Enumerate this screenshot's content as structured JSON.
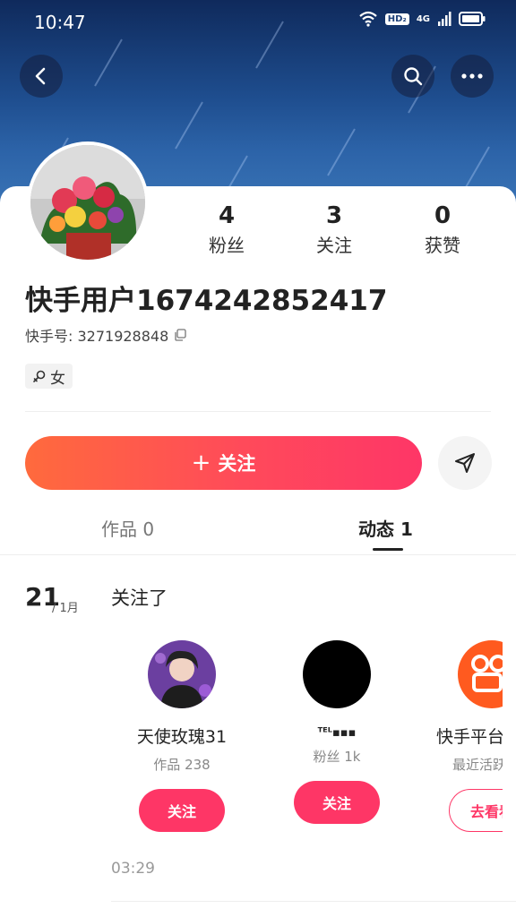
{
  "status_bar": {
    "time": "10:47",
    "hd_badge": "HD₂",
    "network": "4G"
  },
  "header": {
    "icons": [
      "back-icon",
      "search-icon",
      "more-icon"
    ]
  },
  "profile": {
    "name": "快手用户1674242852417",
    "id_label": "快手号: 3271928848",
    "gender": "女",
    "stats": [
      {
        "value": "4",
        "label": "粉丝"
      },
      {
        "value": "3",
        "label": "关注"
      },
      {
        "value": "0",
        "label": "获赞"
      }
    ]
  },
  "actions": {
    "follow_label": "关注",
    "follow_plus": "+"
  },
  "tabs": [
    {
      "label": "作品 0",
      "active": false
    },
    {
      "label": "动态 1",
      "active": true
    }
  ],
  "feed": {
    "date_day": "21",
    "date_month": "/ 1月",
    "title": "关注了",
    "cards": [
      {
        "name": "天使玫瑰31",
        "sub": "作品 238",
        "button": "关注"
      },
      {
        "name": "ᵀᴱᴸ▪▪▪",
        "sub": "粉丝 1k",
        "button": "关注"
      },
      {
        "name": "快手平台",
        "sub": "最近活跃",
        "button": "去看看"
      }
    ],
    "time": "03:29"
  },
  "colors": {
    "accent": "#fe3666",
    "gradient_start": "#ff6a3d",
    "banner": "#1e4d8e"
  }
}
